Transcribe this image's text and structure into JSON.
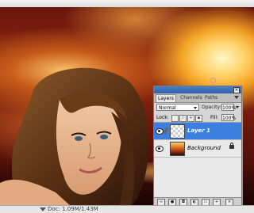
{
  "layers_panel": {
    "tabs": [
      {
        "label": "Layers",
        "active": true
      },
      {
        "label": "Channels",
        "active": false
      },
      {
        "label": "Paths",
        "active": false
      }
    ],
    "blend_mode": "Normal",
    "opacity_label": "Opacity:",
    "opacity_value": "100%",
    "lock_label": "Lock:",
    "fill_label": "Fill:",
    "fill_value": "100%",
    "layers": [
      {
        "name": "Layer 1",
        "selected": true,
        "visible": true,
        "thumbnail": "transparent-checker"
      },
      {
        "name": "Background",
        "selected": false,
        "visible": true,
        "locked": true,
        "thumbnail": "sunset"
      }
    ],
    "footer_icons": [
      "link-icon",
      "fx-icon",
      "mask-icon",
      "adjustment-icon",
      "group-icon",
      "new-layer-icon",
      "trash-icon"
    ]
  },
  "status": {
    "prefix": "",
    "doc_text": "Doc: 1.09M/1.43M"
  },
  "colors": {
    "selection_blue": "#3b7fe0",
    "panel_gray": "#d6d6d6",
    "title_blue": "#2f5fa8"
  }
}
